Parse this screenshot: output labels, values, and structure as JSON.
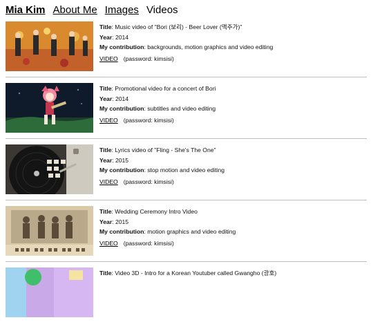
{
  "nav": {
    "brand": "Mia Kim",
    "about": "About Me",
    "images": "Images",
    "current": "Videos"
  },
  "labels": {
    "title": "Title",
    "year": "Year",
    "contribution": "My contribution"
  },
  "entries": [
    {
      "title": "Music video of \"Bori (보리) - Beer Lover (맥주가)\"",
      "year": "2014",
      "contribution": "backgrounds, motion graphics and video editing",
      "link": "VIDEO",
      "password": "(password: kimsisi)"
    },
    {
      "title": "Promotional video for a concert of Bori",
      "year": "2014",
      "contribution": "subtitles and video editing",
      "link": "VIDEO",
      "password": "(password: kimsisi)"
    },
    {
      "title": "Lyrics video of \"Fling - She's The One\"",
      "year": "2015",
      "contribution": "stop motion and video editing",
      "link": "VIDEO",
      "password": "(password: kimsisi)"
    },
    {
      "title": "Wedding Ceremony Intro Video",
      "year": "2015",
      "contribution": "motion graphics and video editing",
      "link": "VIDEO",
      "password": "(password: kimsisi)"
    },
    {
      "title": "Video 3D - Intro for a Korean Youtuber called Gwangho (광호)"
    }
  ]
}
